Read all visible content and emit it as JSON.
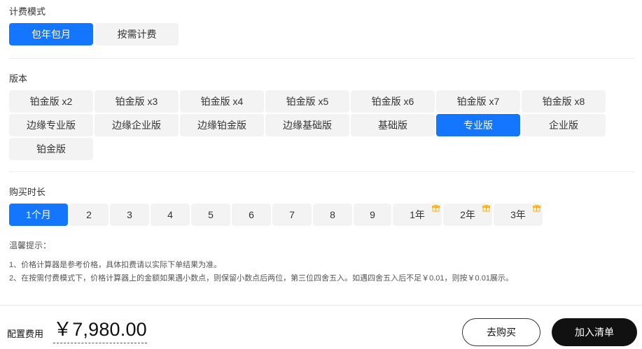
{
  "billing": {
    "label": "计费模式",
    "options": [
      "包年包月",
      "按需计费"
    ],
    "selected": "包年包月"
  },
  "edition": {
    "label": "版本",
    "options": [
      "铂金版 x2",
      "铂金版 x3",
      "铂金版 x4",
      "铂金版 x5",
      "铂金版 x6",
      "铂金版 x7",
      "铂金版 x8",
      "边缘专业版",
      "边缘企业版",
      "边缘铂金版",
      "边缘基础版",
      "基础版",
      "专业版",
      "企业版",
      "铂金版"
    ],
    "selected": "专业版"
  },
  "duration": {
    "label": "购买时长",
    "options": [
      "1个月",
      "2",
      "3",
      "4",
      "5",
      "6",
      "7",
      "8",
      "9",
      "1年",
      "2年",
      "3年"
    ],
    "selected": "1个月",
    "gift_icon": "gift-icon",
    "accent": "#f5a623"
  },
  "notes": {
    "title": "温馨提示：",
    "items": [
      "1、价格计算器是参考价格，具体扣费请以实际下单结果为准。",
      "2、在按需付费模式下，价格计算器上的金额如果遇小数点，则保留小数点后两位，第三位四舍五入。如遇四舍五入后不足￥0.01，则按￥0.01展示。"
    ]
  },
  "footer": {
    "fee_label": "配置费用",
    "price": "￥7,980.00",
    "buy_label": "去购买",
    "cart_label": "加入清单"
  },
  "colors": {
    "accent": "#1476ff",
    "dark_button": "#111111",
    "option_bg": "#f3f3f3"
  }
}
